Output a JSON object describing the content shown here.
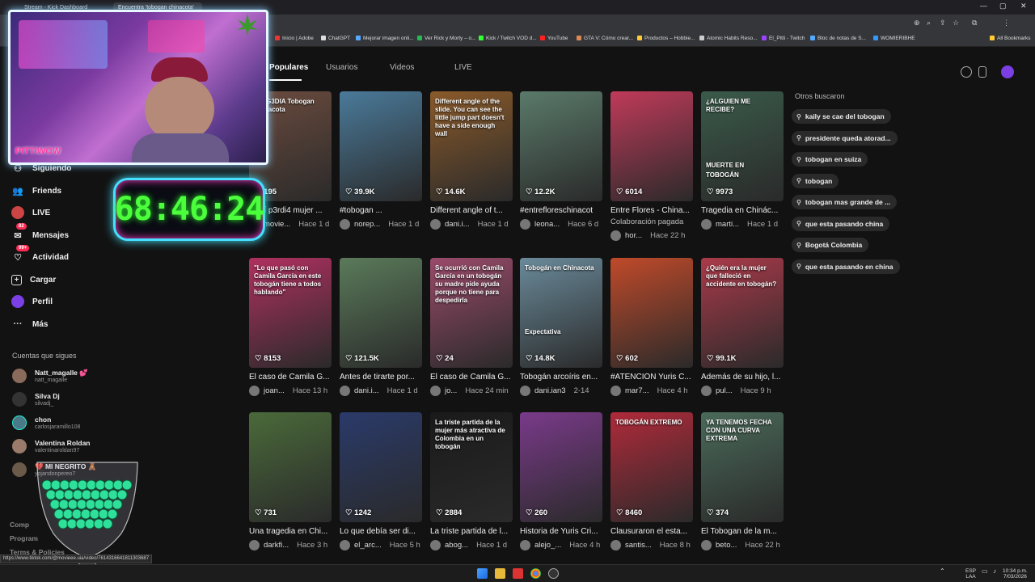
{
  "browser": {
    "tabs": [
      "Stream - Kick Dashboard",
      "Encuentra 'tobogan chinacota'"
    ],
    "bookmarks": [
      "Inicio | Adobe",
      "ChatGPT",
      "Mejorar imagen onli...",
      "Ver Rick y Morty – o...",
      "Kick / Twitch VOD d...",
      "YouTube",
      "GTA V: Cómo crear...",
      "Productos – Hobbie...",
      "Atomic Habits Reso...",
      "El_Pitti - Twitch",
      "Bloc de notas de S...",
      "WOMIERIBHE",
      "All Bookmarks"
    ],
    "status_url": "https://www.tiktok.com/@movieee.uia/video/7614316641811303687"
  },
  "nav_tabs": [
    "Populares",
    "Usuarios",
    "Videos",
    "LIVE"
  ],
  "sidebar": {
    "items": [
      {
        "label": "Siguiendo",
        "icon": "following-icon"
      },
      {
        "label": "Friends",
        "icon": "friends-icon"
      },
      {
        "label": "LIVE",
        "icon": "live-icon"
      },
      {
        "label": "Mensajes",
        "icon": "messages-icon",
        "badge": "82"
      },
      {
        "label": "Actividad",
        "icon": "activity-icon",
        "badge": "99+"
      },
      {
        "label": "Cargar",
        "icon": "upload-icon"
      },
      {
        "label": "Perfil",
        "icon": "profile-icon"
      },
      {
        "label": "Más",
        "icon": "more-icon"
      }
    ],
    "following_title": "Cuentas que sigues",
    "following": [
      {
        "name": "Natt_magalle 💕",
        "handle": "natt_magalle"
      },
      {
        "name": "Silva Dj",
        "handle": "silvadj_"
      },
      {
        "name": "chon",
        "handle": "carlosjaramillo108"
      },
      {
        "name": "Valentina Roldan",
        "handle": "valentinaroldan97"
      },
      {
        "name": "💔 MI NEGRITO 🧸",
        "handle": "yojandonpereo7"
      }
    ],
    "footer": [
      "Comp",
      "Program",
      "Terms & Policies"
    ]
  },
  "videos": [
    {
      "views": "195",
      "caption": "cristí p3rdi4 mujer ...",
      "user": "movie...",
      "time": "Hace 1 d",
      "overlay": "TR4G3DIA Tobogan Chinacota",
      "color": "#6b4b3e"
    },
    {
      "views": "39.9K",
      "caption": "#tobogan ...",
      "user": "norep...",
      "time": "Hace 1 d",
      "color": "#4a7a9a"
    },
    {
      "views": "14.6K",
      "caption": "Different angle of t...",
      "user": "dani.i...",
      "time": "Hace 1 d",
      "overlay": "Different angle of the slide. You can see the little jump part doesn't have a side enough wall",
      "color": "#8a5a2a"
    },
    {
      "views": "12.2K",
      "caption": "#entrefloreschinacot",
      "user": "leona...",
      "time": "Hace 6 d",
      "color": "#5a7a6a"
    },
    {
      "views": "6014",
      "caption": "Entre Flores - China...",
      "user": "hor...",
      "time": "Hace 22 h",
      "sponsored": "Colaboración pagada",
      "color": "#c03a5a"
    },
    {
      "views": "9973",
      "caption": "Tragedia en Chinác...",
      "user": "marti...",
      "time": "Hace 1 d",
      "overlay": "¿ALGUIEN ME RECIBE?",
      "overlay2": "MUERTE EN TOBOGÁN",
      "color": "#3a5a4a"
    },
    {
      "views": "8153",
      "caption": "El caso de Camila G...",
      "user": "joan...",
      "time": "Hace 13 h",
      "overlay": "\"Lo que pasó con Camila García en este tobogán tiene a todos hablando\"",
      "color": "#b03060"
    },
    {
      "views": "121.5K",
      "caption": "Antes de tirarte por...",
      "user": "dani.i...",
      "time": "Hace 1 d",
      "color": "#5a7a5a"
    },
    {
      "views": "24",
      "caption": "El caso de Camila G...",
      "user": "jo...",
      "time": "Hace 24 min",
      "overlay": "Se ocurrió con Camila García en un tobogán su madre pide ayuda porque no tiene para despedirla",
      "color": "#9a4a6a"
    },
    {
      "views": "14.8K",
      "caption": "Tobogán arcoíris en...",
      "user": "dani.ian3",
      "time": "2-14",
      "overlay": "Tobogán en Chinacota",
      "overlay2": "Expectativa",
      "color": "#6a8a9a"
    },
    {
      "views": "602",
      "caption": "#ATENCIÓN Yuris C...",
      "user": "mar7...",
      "time": "Hace 4 h",
      "color": "#c04a2a"
    },
    {
      "views": "99.1K",
      "caption": "Además de su hijo, l...",
      "user": "pul...",
      "time": "Hace 9 h",
      "overlay": "¿Quién era la mujer que falleció en accidente en tobogán?",
      "color": "#aa3a4a"
    },
    {
      "views": "731",
      "caption": "Una tragedia en Chi...",
      "user": "darkfi...",
      "time": "Hace 3 h",
      "color": "#4a6a3a"
    },
    {
      "views": "1242",
      "caption": "Lo que debía ser di...",
      "user": "el_arc...",
      "time": "Hace 5 h",
      "color": "#2a3a6a"
    },
    {
      "views": "2884",
      "caption": "La triste partida de l...",
      "user": "abog...",
      "time": "Hace 1 d",
      "overlay": "La triste partida de la mujer más atractiva de Colombia en un tobogán",
      "color": "#1a1a1a"
    },
    {
      "views": "260",
      "caption": "Historia de Yuris Cri...",
      "user": "alejo_...",
      "time": "Hace 4 h",
      "color": "#7a3a8a"
    },
    {
      "views": "8460",
      "caption": "Clausuraron el esta...",
      "user": "santis...",
      "time": "Hace 8 h",
      "overlay": "TOBOGÁN EXTREMO",
      "color": "#b02a3a"
    },
    {
      "views": "374",
      "caption": "El Tobogan de la m...",
      "user": "beto...",
      "time": "Hace 22 h",
      "overlay": "YA TENEMOS FECHA CON UNA CURVA EXTREMA",
      "color": "#4a6a5a"
    }
  ],
  "others_title": "Otros buscaron",
  "others": [
    "kaily se cae del tobogan",
    "presidente queda atorad...",
    "tobogan en suiza",
    "tobogan",
    "tobogan mas grande de ...",
    "que esta pasando china",
    "Bogotá Colombia",
    "que esta pasando en china"
  ],
  "overlay": {
    "timer": "68:46:24",
    "logo": "PITTIWOW"
  },
  "taskbar": {
    "lang": "ESP",
    "lang2": "LAA",
    "time": "10:34 p.m.",
    "date": "7/03/2026"
  }
}
